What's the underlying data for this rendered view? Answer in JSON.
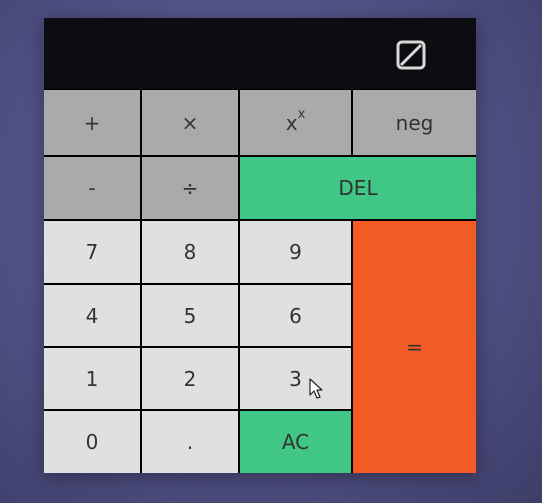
{
  "display": {
    "value": ""
  },
  "header": {
    "icon": "no-symbol-icon"
  },
  "keys": {
    "plus": "+",
    "times": "×",
    "pow_base": "x",
    "pow_exp": "x",
    "neg": "neg",
    "minus": "-",
    "divide": "÷",
    "del": "DEL",
    "seven": "7",
    "eight": "8",
    "nine": "9",
    "four": "4",
    "five": "5",
    "six": "6",
    "one": "1",
    "two": "2",
    "three": "3",
    "zero": "0",
    "dot": ".",
    "ac": "AC",
    "equals": "="
  },
  "colors": {
    "operator": "#aaaaaa",
    "number": "#e0e0e0",
    "accent_green": "#40c685",
    "accent_orange": "#f25b25",
    "display_bg": "#0d0c11"
  }
}
